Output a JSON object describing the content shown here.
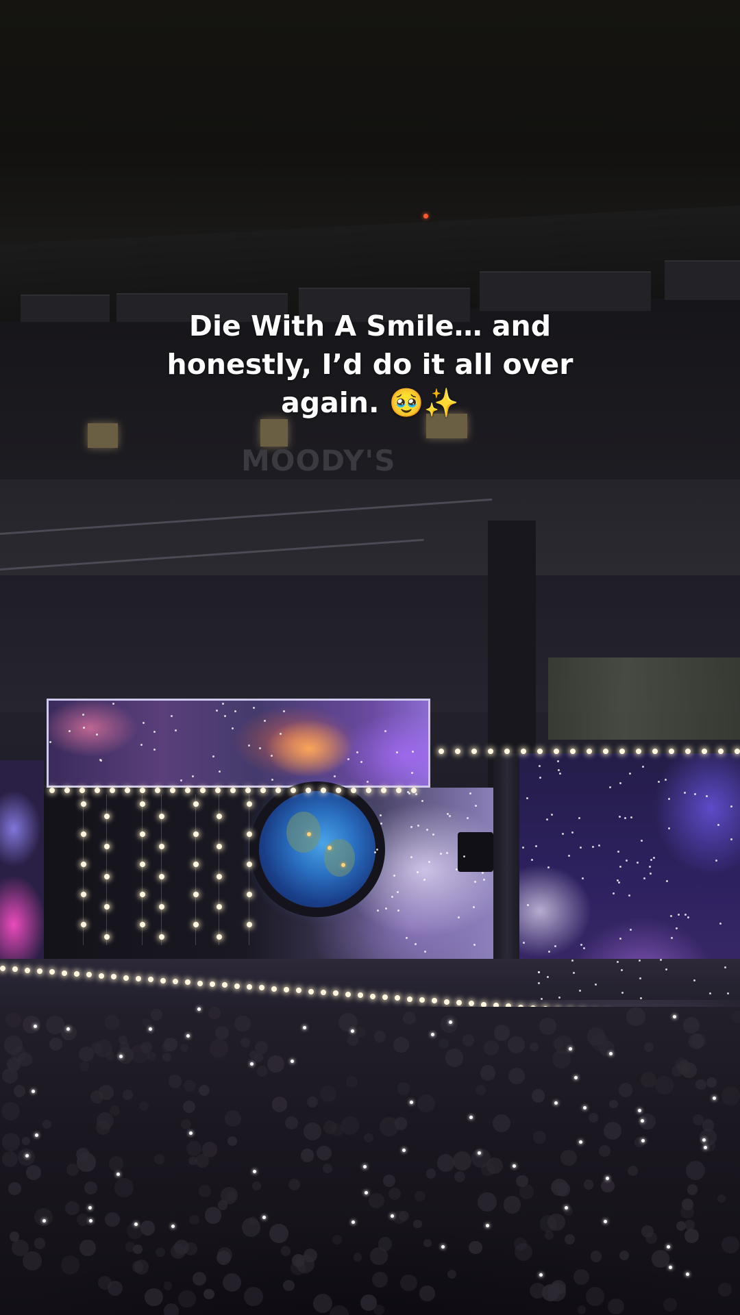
{
  "caption": {
    "text": "Die With A Smile… and\nhonestly, I’d do it all over\nagain. 🥹✨"
  },
  "venue_sign": {
    "text": "MOODY'S"
  },
  "colors": {
    "caption": "#ffffff",
    "background": "#0b0a0a",
    "screen_purple": "#6a4aa0",
    "globe_blue": "#2a6fc0"
  }
}
